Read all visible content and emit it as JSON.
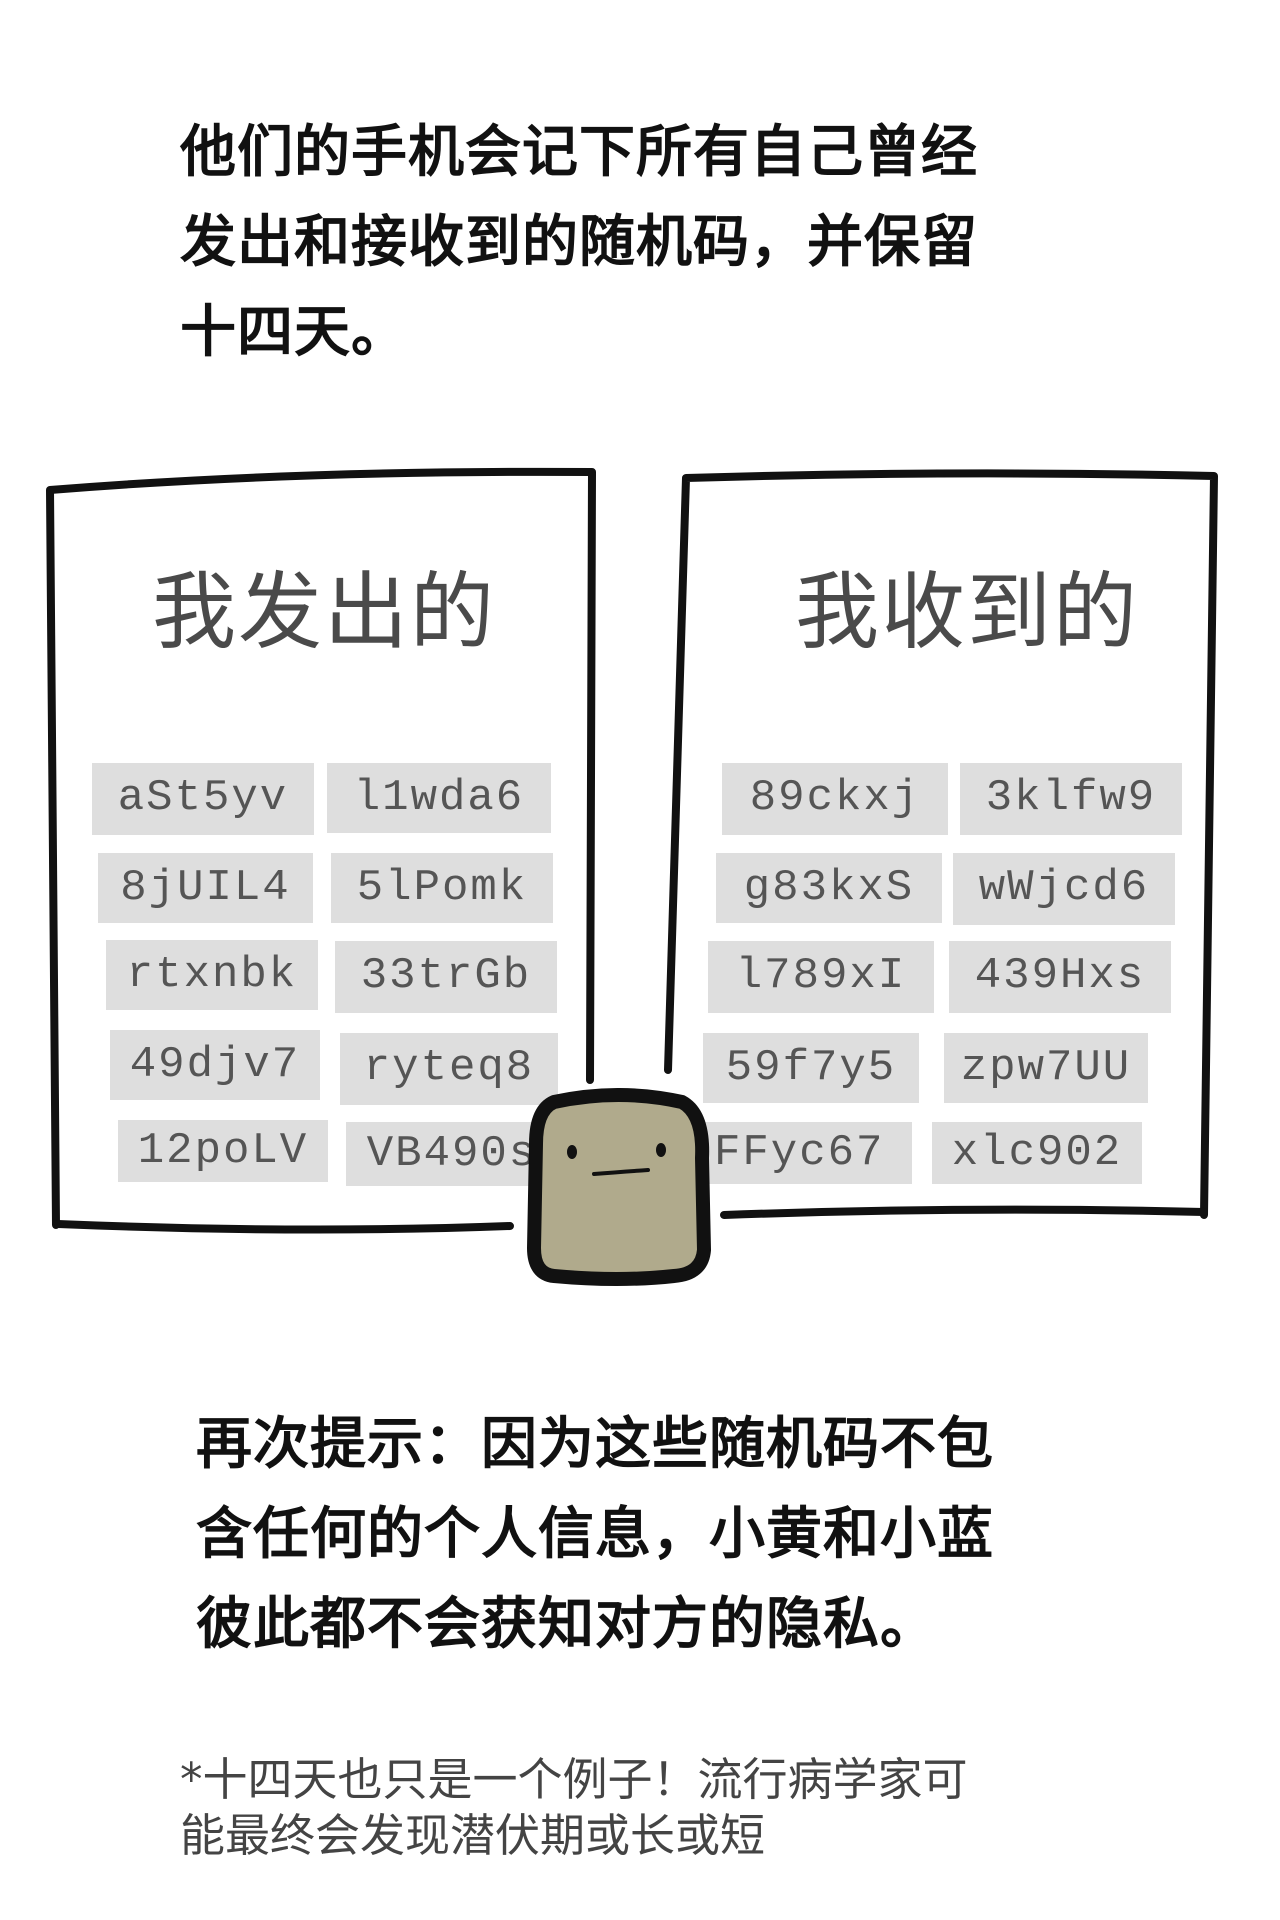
{
  "intro": {
    "lines": [
      "他们的手机会记下所有自己曾经",
      "发出和接收到的随机码，并保留",
      "十四天。"
    ]
  },
  "sent_list": {
    "title": "我发出的",
    "codes": [
      "aSt5yv",
      "l1wda6",
      "8jUIL4",
      "5lPomk",
      "rtxnbk",
      "33trGb",
      "49djv7",
      "ryteq8",
      "12poLV",
      "VB490s"
    ]
  },
  "received_list": {
    "title": "我收到的",
    "codes": [
      "89ckxj",
      "3klfw9",
      "g83kxS",
      "wWjcd6",
      "l789xI",
      "439Hxs",
      "59f7y5",
      "zpw7UU",
      "FFyc67",
      "xlc902"
    ]
  },
  "reminder": {
    "lines": [
      "再次提示：因为这些随机码不包",
      "含任何的个人信息，小黄和小蓝",
      "彼此都不会获知对方的隐私。"
    ]
  },
  "footnote": {
    "lines": [
      "*十四天也只是一个例子！流行病学家可",
      "能最终会发现潜伏期或长或短"
    ]
  },
  "colors": {
    "ink": "#111111",
    "chip_fill": "#dedede",
    "chip_text": "#555555",
    "mascot_body": "#b0aa8c"
  }
}
